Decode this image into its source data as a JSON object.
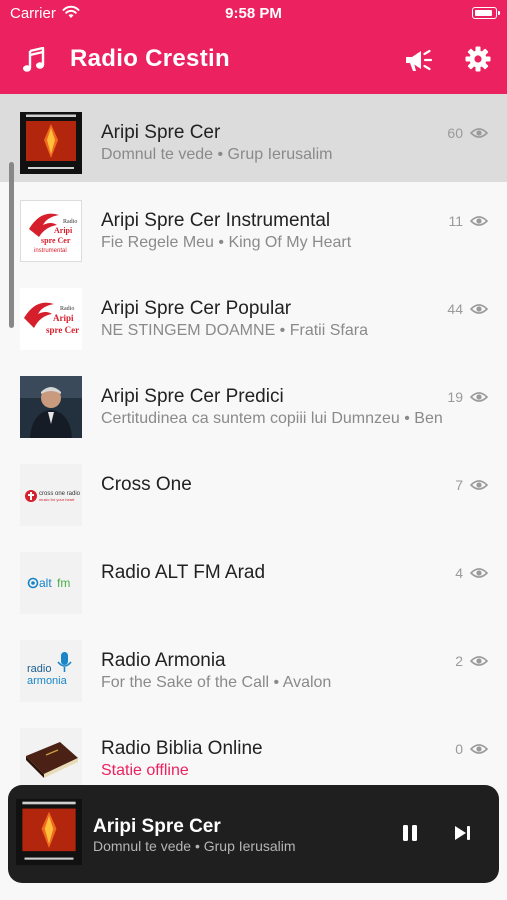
{
  "status_bar": {
    "carrier": "Carrier",
    "time": "9:58 PM"
  },
  "header": {
    "title": "Radio Crestin",
    "left_icon": "music-note-icon",
    "right_icons": [
      "megaphone-icon",
      "gear-icon"
    ]
  },
  "colors": {
    "accent": "#ec2160",
    "offline": "#ec2160",
    "player_bg": "#1f1f1f"
  },
  "stations": [
    {
      "name": "Aripi Spre Cer",
      "subtitle": "Domnul te vede • Grup Ierusalim",
      "listeners": "60",
      "selected": true,
      "offline": false,
      "logo_text": "GRUP IERUSALIM"
    },
    {
      "name": "Aripi Spre Cer Instrumental",
      "subtitle": "Fie Regele Meu • King Of My Heart",
      "listeners": "11",
      "offline": false,
      "logo_text": "Aripi spre Cer instrumental"
    },
    {
      "name": "Aripi Spre Cer Popular",
      "subtitle": "NE STINGEM DOAMNE • Fratii Sfara",
      "listeners": "44",
      "offline": false,
      "logo_text": "Aripi spre Cer"
    },
    {
      "name": "Aripi Spre Cer Predici",
      "subtitle": "Certitudinea ca suntem copiii lui Dumnzeu • Ben",
      "listeners": "19",
      "offline": false,
      "logo_text": ""
    },
    {
      "name": "Cross One",
      "subtitle": "",
      "listeners": "7",
      "offline": false,
      "logo_text": "cross one radio"
    },
    {
      "name": "Radio ALT FM Arad",
      "subtitle": "",
      "listeners": "4",
      "offline": false,
      "logo_text": "altfm"
    },
    {
      "name": "Radio Armonia",
      "subtitle": "For the Sake of the Call • Avalon",
      "listeners": "2",
      "offline": false,
      "logo_text": "radio armonia"
    },
    {
      "name": "Radio Biblia Online",
      "subtitle": "Statie offline",
      "listeners": "0",
      "offline": true,
      "logo_text": ""
    }
  ],
  "player": {
    "title": "Aripi Spre Cer",
    "subtitle": "Domnul te vede • Grup Ierusalim",
    "play_state": "playing",
    "icons": [
      "pause-icon",
      "next-icon"
    ]
  }
}
